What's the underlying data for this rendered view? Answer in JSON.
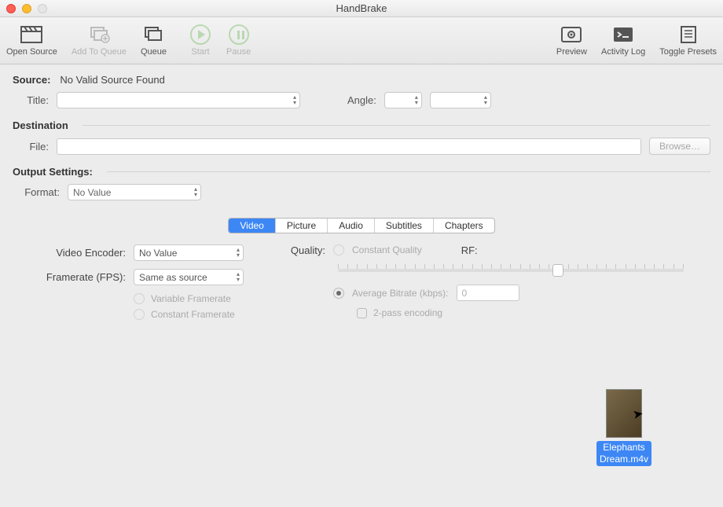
{
  "window": {
    "title": "HandBrake"
  },
  "toolbar": {
    "open_source": "Open Source",
    "add_to_queue": "Add To Queue",
    "queue": "Queue",
    "start": "Start",
    "pause": "Pause",
    "preview": "Preview",
    "activity_log": "Activity Log",
    "toggle_presets": "Toggle Presets"
  },
  "source": {
    "label": "Source:",
    "status": "No Valid Source Found",
    "title_label": "Title:",
    "title_value": "",
    "angle_label": "Angle:",
    "angle_value": "",
    "range_value": ""
  },
  "destination": {
    "heading": "Destination",
    "file_label": "File:",
    "file_value": "",
    "browse": "Browse…"
  },
  "output": {
    "heading": "Output Settings:",
    "format_label": "Format:",
    "format_value": "No Value"
  },
  "tabs": [
    "Video",
    "Picture",
    "Audio",
    "Subtitles",
    "Chapters"
  ],
  "active_tab": "Video",
  "video": {
    "encoder_label": "Video Encoder:",
    "encoder_value": "No Value",
    "fps_label": "Framerate (FPS):",
    "fps_value": "Same as source",
    "vfr": "Variable Framerate",
    "cfr": "Constant Framerate",
    "quality_label": "Quality:",
    "cq": "Constant Quality",
    "rf_label": "RF:",
    "abr": "Average Bitrate (kbps):",
    "abr_value": "0",
    "twopass": "2-pass encoding"
  },
  "dragged_file": {
    "name_line1": "Elephants",
    "name_line2": "Dream.m4v"
  }
}
